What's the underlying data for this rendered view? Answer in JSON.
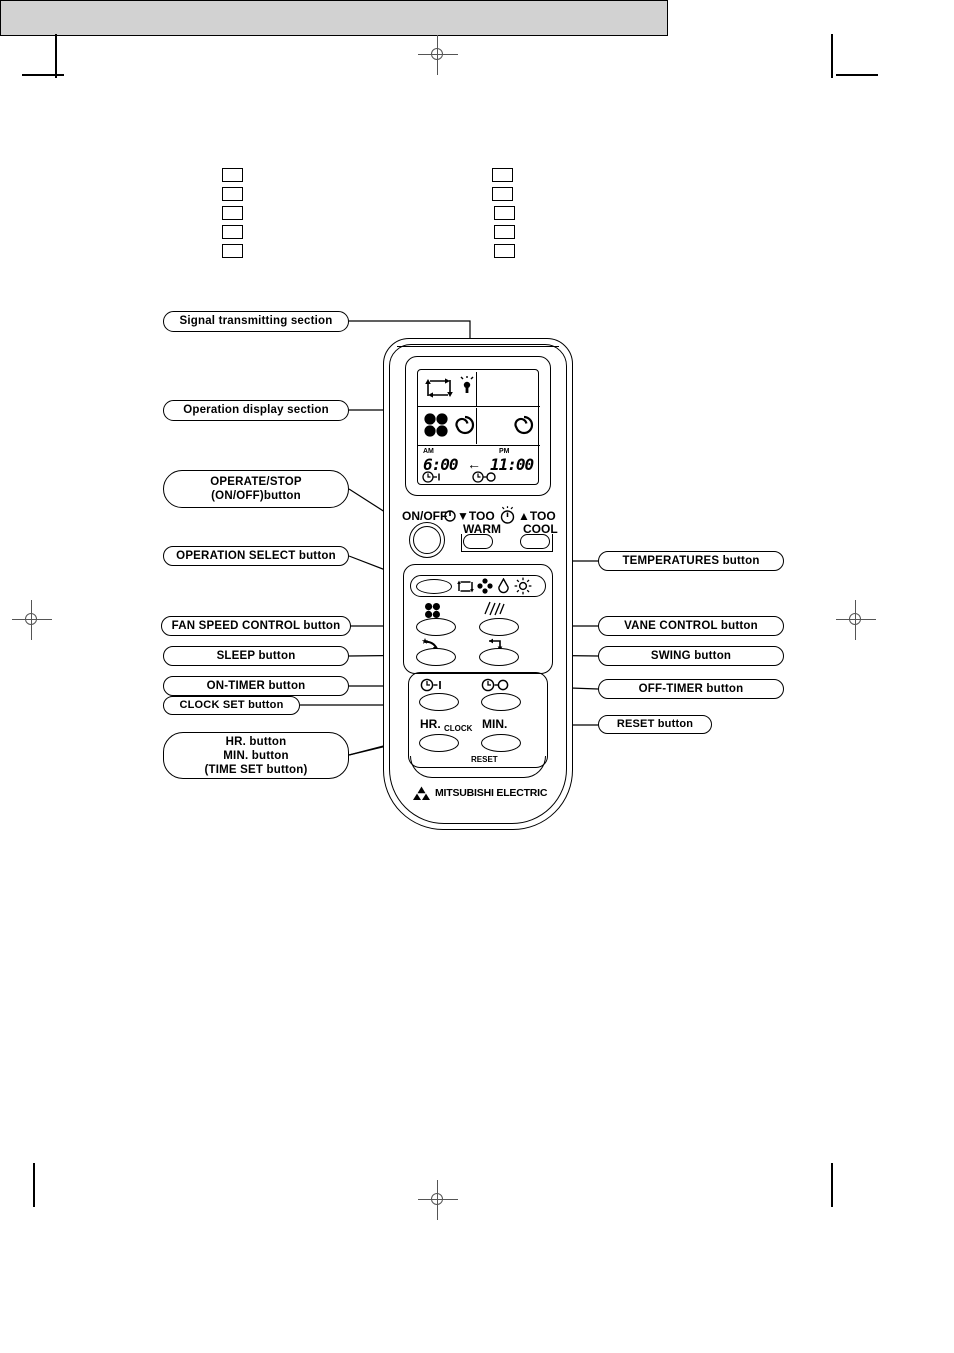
{
  "page": {
    "header_band_text": "",
    "checkbox_count_left": 5,
    "checkbox_count_right": 5
  },
  "callouts": {
    "left": [
      {
        "id": "signal-transmitting-section",
        "label": "Signal transmitting section"
      },
      {
        "id": "operation-display-section",
        "label": "Operation display section"
      },
      {
        "id": "operate-stop-button",
        "label": "OPERATE/STOP\n(ON/OFF)button",
        "line1": "OPERATE/STOP",
        "line2": "(ON/OFF)button"
      },
      {
        "id": "operation-select-button",
        "label": "OPERATION SELECT button"
      },
      {
        "id": "fan-speed-control-button",
        "label": "FAN SPEED CONTROL button"
      },
      {
        "id": "sleep-button",
        "label": "SLEEP button"
      },
      {
        "id": "on-timer-button",
        "label": "ON-TIMER button"
      },
      {
        "id": "clock-set-button",
        "label": "CLOCK SET button"
      },
      {
        "id": "time-set-button",
        "line1": "HR. button",
        "line2": "MIN. button",
        "line3": "(TIME SET button)"
      }
    ],
    "right": [
      {
        "id": "temperatures-button",
        "label": "TEMPERATURES button"
      },
      {
        "id": "vane-control-button",
        "label": "VANE CONTROL button"
      },
      {
        "id": "swing-button",
        "label": "SWING button"
      },
      {
        "id": "off-timer-button",
        "label": "OFF-TIMER button"
      },
      {
        "id": "reset-button",
        "label": "RESET button"
      }
    ]
  },
  "remote": {
    "brand": "MITSUBISHI ELECTRIC",
    "display": {
      "vane_icon": "circulation-arrows-icon",
      "transmit_icon": "transmit-signal-icon",
      "fan_icon": "fan-icon",
      "swing_icon_left": "swirl-icon",
      "swing_icon_right": "swirl-icon",
      "on_timer": {
        "meridiem": "AM",
        "time": "6:00",
        "icon": "on-timer-icon"
      },
      "off_timer": {
        "meridiem": "PM",
        "time": "11:00",
        "icon": "off-timer-icon"
      },
      "arrow": "←"
    },
    "top_row": {
      "onoff_label": "ON/OFF",
      "power_icon": "power-icon",
      "too_warm": "▼ TOO\nWARM",
      "too_warm_line1": "▼TOO",
      "too_warm_line2": "WARM",
      "thermometer_icon": "thermometer-icon",
      "too_cool_line1": "▲TOO",
      "too_cool_line2": "COOL"
    },
    "mode_row": {
      "icons": [
        "auto-circulation-icon",
        "cool-snowflake-icon",
        "dry-drop-icon",
        "heat-sun-icon"
      ]
    },
    "control_icons": {
      "fan": "fan-icon",
      "vane": "vane-lines-icon",
      "sleep": "sleep-moon-star-icon",
      "swing": "swing-arrow-icon"
    },
    "timer_plate": {
      "on_timer_icon": "on-timer-icon",
      "off_timer_icon": "off-timer-icon",
      "hr_label": "HR.",
      "clock_label": "CLOCK",
      "min_label": "MIN.",
      "reset_label": "RESET"
    }
  }
}
